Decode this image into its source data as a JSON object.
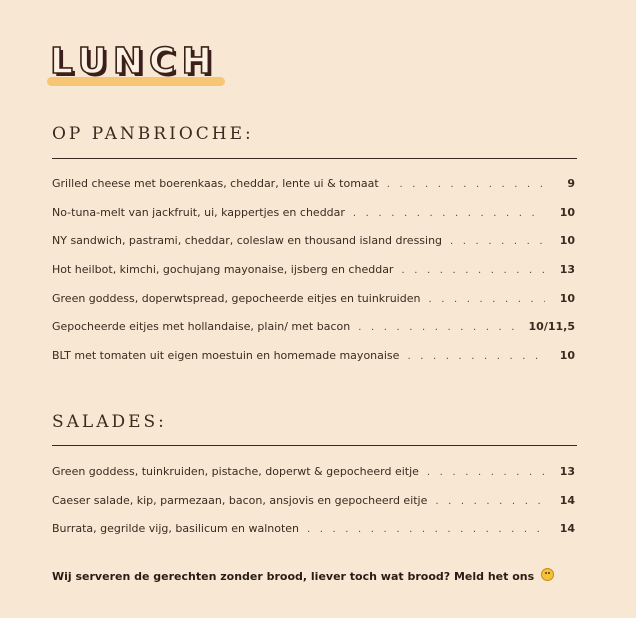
{
  "page": {
    "title": "LUNCH",
    "colors": {
      "background": "#f8e8d3",
      "text": "#3a2a20",
      "accent_underline": "#f6c674"
    }
  },
  "sections": [
    {
      "heading": "OP PANBRIOCHE:",
      "items": [
        {
          "name": "Grilled cheese met boerenkaas, cheddar, lente ui & tomaat",
          "price": "9"
        },
        {
          "name": "No-tuna-melt van jackfruit, ui, kappertjes en cheddar",
          "price": "10"
        },
        {
          "name": "NY sandwich, pastrami, cheddar, coleslaw en thousand island dressing",
          "price": "10"
        },
        {
          "name": "Hot heilbot, kimchi, gochujang mayonaise, ijsberg en cheddar",
          "price": "13"
        },
        {
          "name": "Green goddess, doperwtspread, gepocheerde eitjes en tuinkruiden",
          "price": "10"
        },
        {
          "name": "Gepocheerde eitjes met hollandaise, plain/ met bacon",
          "price": "10/11,5"
        },
        {
          "name": "BLT met tomaten uit eigen moestuin en homemade mayonaise",
          "price": "10"
        }
      ]
    },
    {
      "heading": "SALADES:",
      "items": [
        {
          "name": "Green goddess, tuinkruiden, pistache, doperwt & gepocheerd eitje",
          "price": "13"
        },
        {
          "name": "Caeser salade, kip, parmezaan, bacon, ansjovis en gepocheerd eitje",
          "price": "14"
        },
        {
          "name": "Burrata, gegrilde vijg, basilicum en walnoten",
          "price": "14"
        }
      ]
    }
  ],
  "note": {
    "text": "Wij serveren de gerechten zonder brood, liever toch wat brood? Meld het ons",
    "emoji_icon": "smiley-emoji-icon"
  }
}
